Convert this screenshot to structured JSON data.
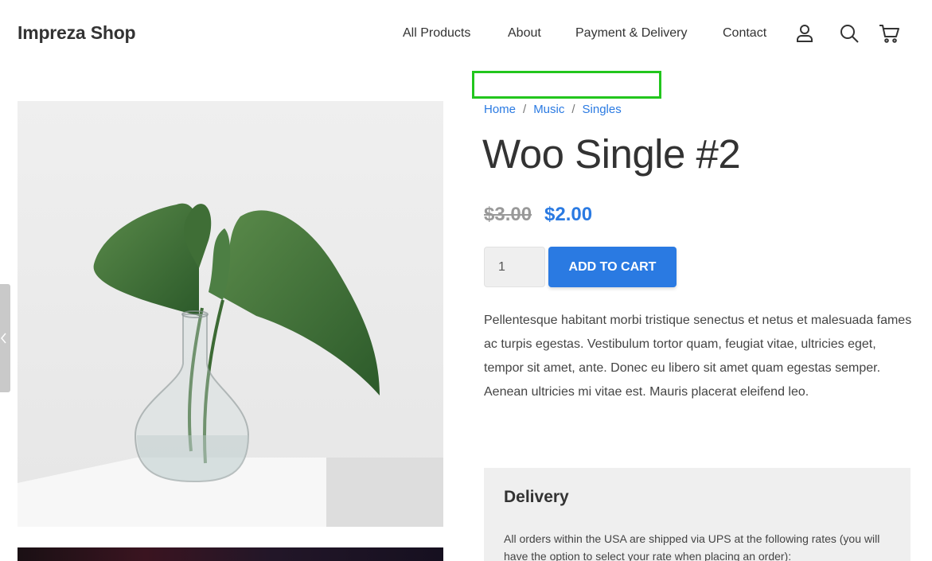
{
  "header": {
    "logo": "Impreza Shop",
    "nav": {
      "all_products": "All Products",
      "about": "About",
      "payment_delivery": "Payment & Delivery",
      "contact": "Contact"
    },
    "icons": [
      "user-icon",
      "search-icon",
      "cart-icon"
    ]
  },
  "breadcrumb": {
    "items": [
      "Home",
      "Music",
      "Singles"
    ],
    "separator": "/"
  },
  "product": {
    "title": "Woo Single #2",
    "price_old": "$3.00",
    "price_new": "$2.00",
    "quantity": "1",
    "add_to_cart_label": "ADD TO CART",
    "description": "Pellentesque habitant morbi tristique senectus et netus et malesuada fames ac turpis egestas. Vestibulum tortor quam, feugiat vitae, ultricies eget, tempor sit amet, ante. Donec eu libero sit amet quam egestas semper. Aenean ultricies mi vitae est. Mauris placerat eleifend leo."
  },
  "delivery": {
    "title": "Delivery",
    "text": "All orders within the USA are shipped via UPS at the following rates (you will have the option to select your rate when placing an order):"
  },
  "colors": {
    "accent": "#2a7ae2",
    "highlight": "#22c61d",
    "panel_bg": "#efefef"
  }
}
